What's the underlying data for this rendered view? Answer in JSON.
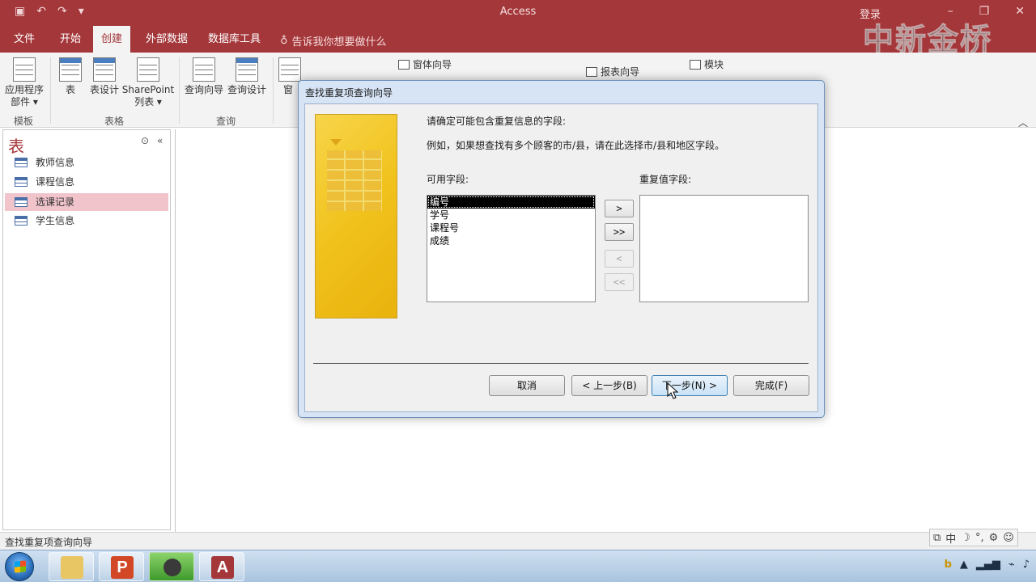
{
  "window": {
    "title": "Access",
    "signin": "登录",
    "watermark": "中新金桥"
  },
  "tabs": [
    "文件",
    "开始",
    "创建",
    "外部数据",
    "数据库工具"
  ],
  "active_tab": "创建",
  "tell_me": "告诉我你想要做什么",
  "ribbon": {
    "templates_group": {
      "label": "模板",
      "app_parts": "应用程序",
      "app_parts2": "部件"
    },
    "tables_group": {
      "label": "表格",
      "table": "表",
      "table_design": "表设计",
      "sharepoint": "SharePoint",
      "sharepoint2": "列表"
    },
    "queries_group": {
      "label": "查询",
      "query_wizard": "查询向导",
      "query_design": "查询设计"
    },
    "forms": {
      "form_partial": "窗",
      "form_wizard": "窗体向导"
    },
    "reports": {
      "report_wizard": "报表向导"
    },
    "macros": {
      "module": "模块"
    }
  },
  "navpane": {
    "header": "表",
    "items": [
      "教师信息",
      "课程信息",
      "选课记录",
      "学生信息"
    ],
    "selected": "选课记录"
  },
  "dialog": {
    "title": "查找重复项查询向导",
    "instruction": "请确定可能包含重复信息的字段:",
    "example": "例如，如果想查找有多个顾客的市/县，请在此选择市/县和地区字段。",
    "available_label": "可用字段:",
    "duplicate_label": "重复值字段:",
    "available_fields": [
      "编号",
      "学号",
      "课程号",
      "成绩"
    ],
    "selected_field": "编号",
    "move": {
      "add_one": ">",
      "add_all": ">>",
      "remove_one": "<",
      "remove_all": "<<"
    },
    "buttons": {
      "cancel": "取消",
      "back": "< 上一步(B)",
      "next": "下一步(N) >",
      "finish": "完成(F)"
    }
  },
  "statusbar": {
    "text": "查找重复项查询向导"
  },
  "colors": {
    "brand": "#a4373a",
    "selection": "#f1c4cc",
    "dialog_frame": "#d6e4f5"
  }
}
